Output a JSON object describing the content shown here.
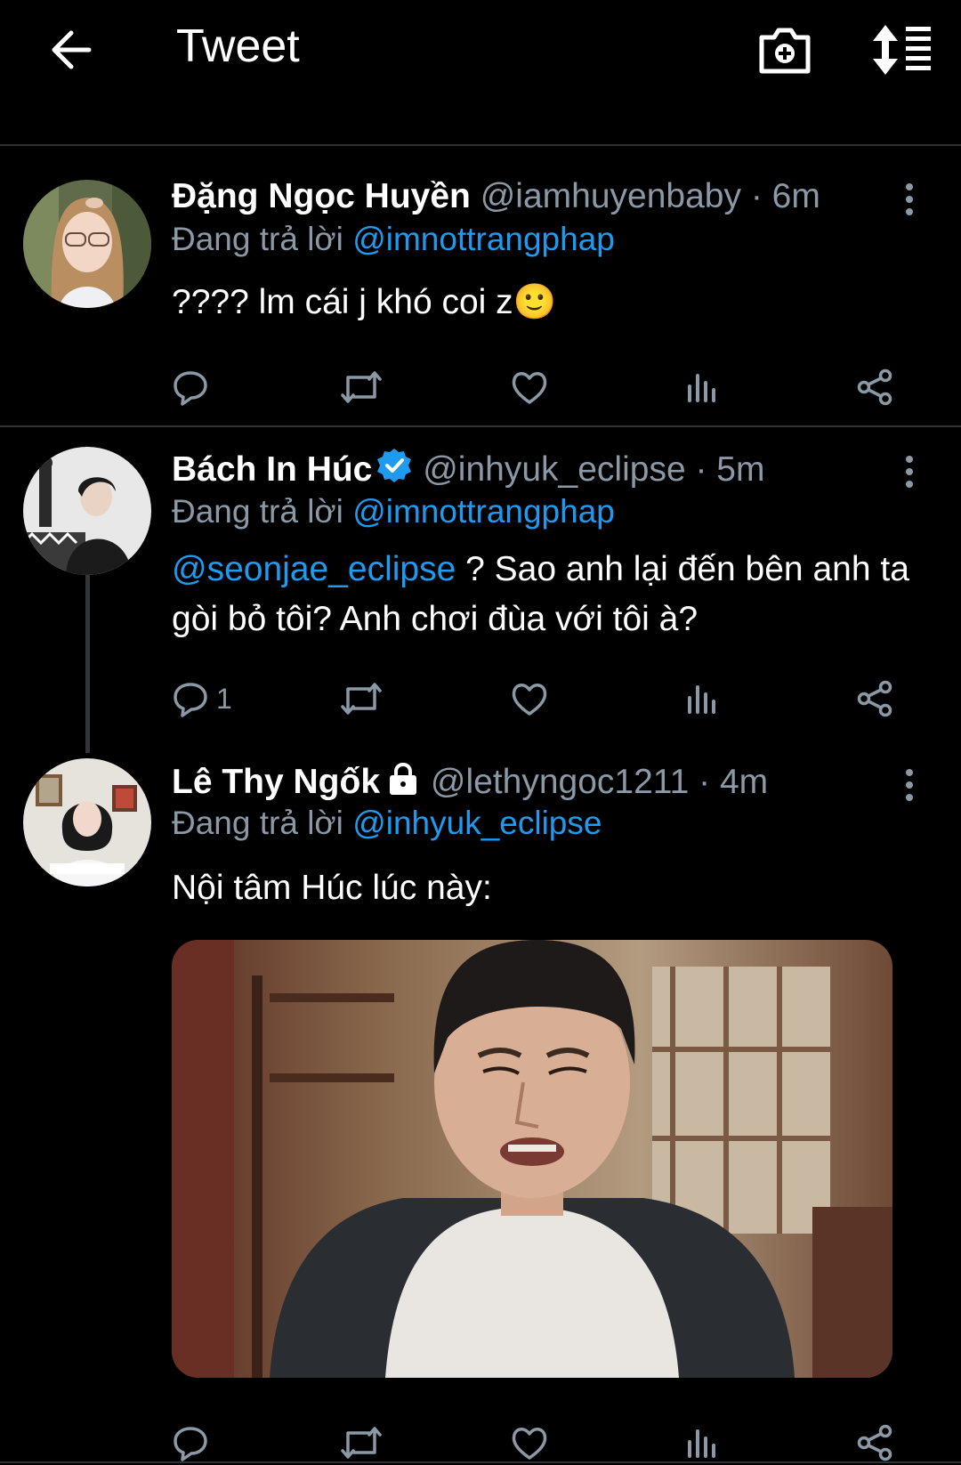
{
  "header": {
    "title": "Tweet"
  },
  "tweets": [
    {
      "name": "Đặng Ngọc Huyền",
      "handle": "@iamhuyenbaby",
      "time": "· 6m",
      "reply_prefix": "Đang trả lời ",
      "reply_to": "@imnottrangphap",
      "text": "???? lm cái j khó coi z",
      "emoji": "🙂",
      "reply_count": ""
    },
    {
      "name": "Bách In Húc",
      "verified": true,
      "handle": "@inhyuk_eclipse",
      "time": "· 5m",
      "reply_prefix": "Đang trả lời ",
      "reply_to": "@imnottrangphap",
      "mention": "@seonjae_eclipse",
      "text_line1": " ? Sao anh lại đến bên anh ta",
      "text_line2": "gòi bỏ tôi? Anh chơi đùa với tôi à?",
      "reply_count": "1"
    },
    {
      "name": "Lê Thy Ngốk",
      "protected": true,
      "handle": "@lethyngoc1211",
      "time": "· 4m",
      "reply_prefix": "Đang trả lời ",
      "reply_to": "@inhyuk_eclipse",
      "text": "Nội tâm Húc lúc này:",
      "reply_count": ""
    }
  ],
  "colors": {
    "accent": "#1d9bf0",
    "muted": "#8b98a5",
    "divider": "#2f3336"
  }
}
